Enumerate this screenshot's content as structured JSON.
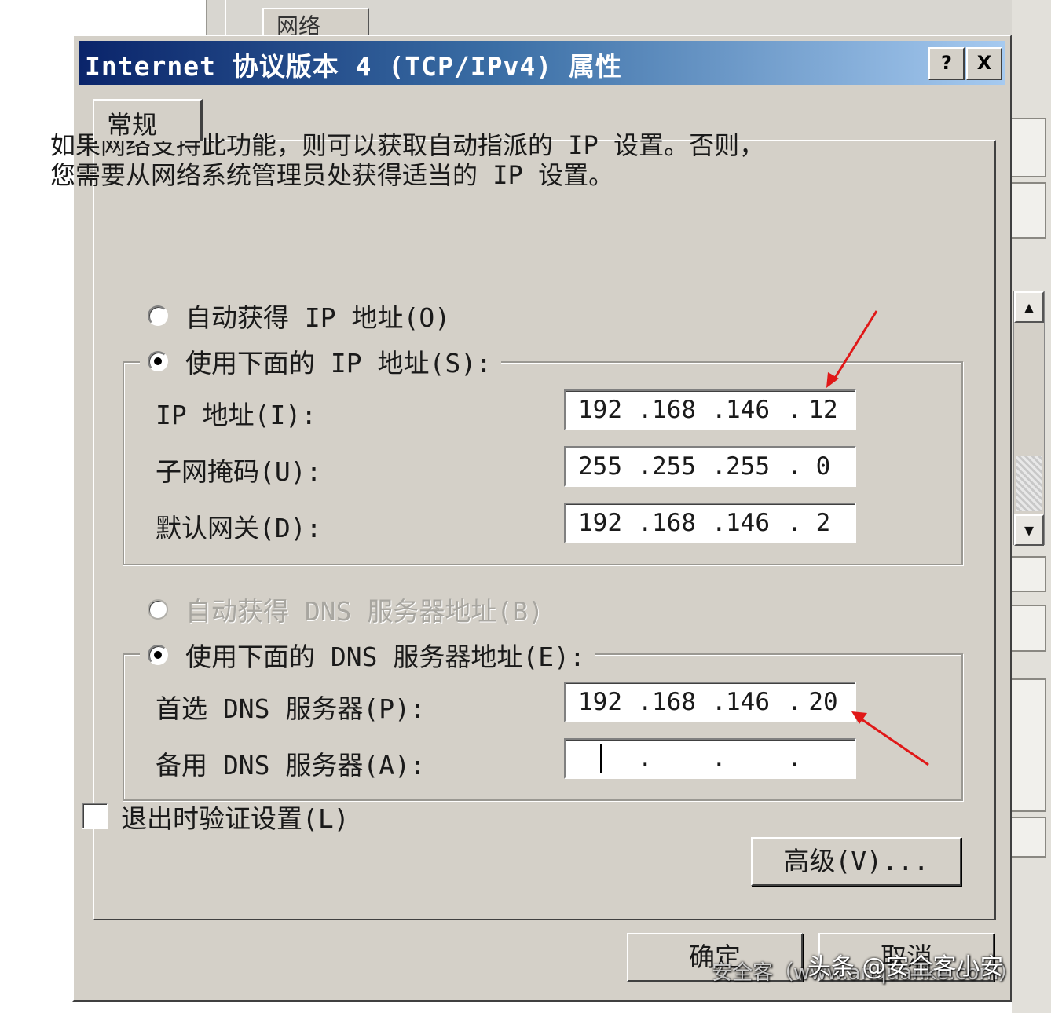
{
  "background": {
    "tab_label": "网络"
  },
  "dialog": {
    "title": "Internet 协议版本 4 (TCP/IPv4) 属性",
    "help_label": "?",
    "close_label": "X",
    "tab_general": "常规",
    "description_line1": "如果网络支持此功能，则可以获取自动指派的 IP 设置。否则，",
    "description_line2": "您需要从网络系统管理员处获得适当的 IP 设置。",
    "ip_auto_label": "自动获得 IP 地址(O)",
    "ip_manual_label": "使用下面的 IP 地址(S):",
    "ip_address_label": "IP 地址(I):",
    "subnet_label": "子网掩码(U):",
    "gateway_label": "默认网关(D):",
    "ip_address": [
      "192",
      "168",
      "146",
      "12"
    ],
    "subnet_mask": [
      "255",
      "255",
      "255",
      "0"
    ],
    "gateway": [
      "192",
      "168",
      "146",
      "2"
    ],
    "dns_auto_label": "自动获得 DNS 服务器地址(B)",
    "dns_manual_label": "使用下面的 DNS 服务器地址(E):",
    "preferred_dns_label": "首选 DNS 服务器(P):",
    "alternate_dns_label": "备用 DNS 服务器(A):",
    "preferred_dns": [
      "192",
      "168",
      "146",
      "20"
    ],
    "alternate_dns": [
      "",
      "",
      "",
      ""
    ],
    "validate_label": "退出时验证设置(L)",
    "advanced_label": "高级(V)...",
    "ok_label": "确定",
    "cancel_label": "取消"
  },
  "watermark": {
    "faint": "安全客（www.anquanke.com）",
    "text": "头条 @安全客小安"
  },
  "annotation_color": "#e01818",
  "selection": {
    "ip_mode": "manual",
    "dns_mode": "manual",
    "dns_auto_enabled": false,
    "validate_checked": false
  }
}
